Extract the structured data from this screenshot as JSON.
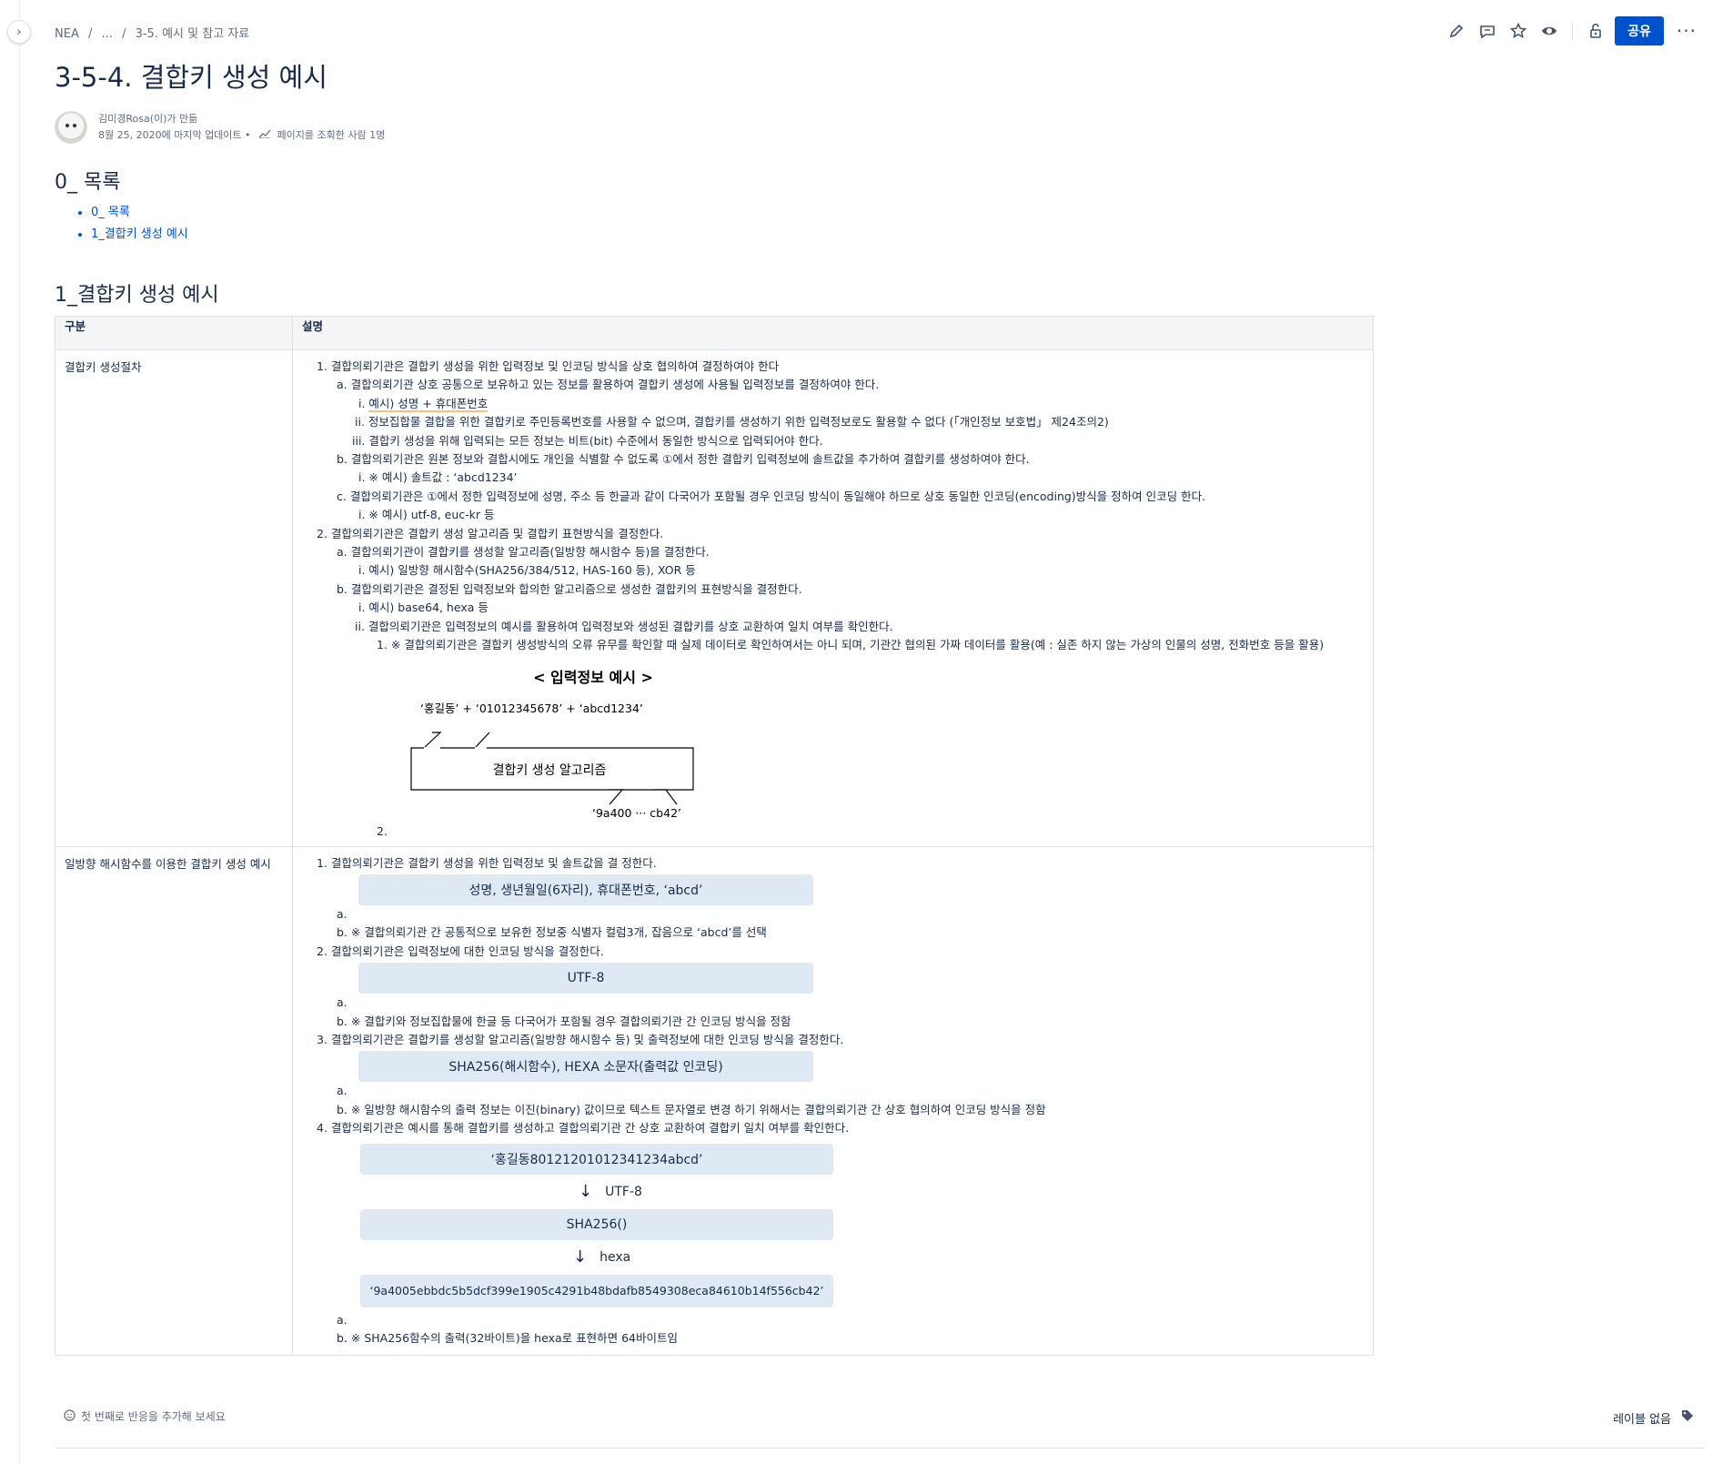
{
  "breadcrumb": {
    "space": "NEA",
    "sep": "/",
    "ellipsis": "...",
    "parent": "3-5. 예시 및 참고 자료"
  },
  "toolbar": {
    "share_label": "공유",
    "more_label": "···"
  },
  "page": {
    "title": "3-5-4. 결합키 생성 예시",
    "author_line": "김미경Rosa(이)가 만듦",
    "updated_line": "8월 25, 2020에 마지막 업데이트 •",
    "views_line": "페이지를 조회한 사람 1명"
  },
  "toc": {
    "heading": "0_ 목록",
    "items": [
      "0_ 목록",
      "1_결합키 생성 예시"
    ]
  },
  "section1": {
    "heading": "1_결합키 생성 예시"
  },
  "table": {
    "headers": [
      "구분",
      "설명"
    ],
    "row1": {
      "label": "결합키 생성절차",
      "lines": [
        "1. 결합의뢰기관은 결합키 생성을 위한 입력정보 및 인코딩 방식을 상호 협의하여 결정하여야 한다",
        "a. 결합의뢰기관 상호 공통으로 보유하고 있는 정보를 활용하여 결합키 생성에 사용될 입력정보를 결정하여야 한다.",
        "i. ",
        "ii. 정보집합물 결합을 위한 결합키로 주민등록번호를 사용할 수 없으며, 결합키를 생성하기 위한 입력정보로도 활용할 수 없다 (「개인정보 보호법」 제24조의2)",
        "iii. 결합키 생성을 위해 입력되는 모든 정보는 비트(bit) 수준에서 동일한 방식으로 입력되어야 한다.",
        "b. 결합의뢰기관은 원본 정보와 결합시에도 개인을 식별할 수 없도록 ①에서 정한 결합키 입력정보에 솔트값을 추가하여 결합키를 생성하여야 한다.",
        "i. ※ 예시) 솔트값 : ‘abcd1234’",
        "c. 결합의뢰기관은 ①에서 정한 입력정보에 성명, 주소 등 한글과 같이 다국어가 포함될 경우 인코딩 방식이 동일해야 하므로 상호 동일한 인코딩(encoding)방식을 정하여 인코딩 한다.",
        "i. ※ 예시) utf-8, euc-kr 등",
        "2. 결합의뢰기관은 결합키 생성 알고리즘 및 결합키 표현방식을 결정한다.",
        "a. 결합의뢰기관이 결합키를 생성할 알고리즘(일방향 해시함수 등)을 결정한다.",
        "i. 예시) 일방향 해시함수(SHA256/384/512, HAS-160 등), XOR 등",
        "b. 결합의뢰기관은 결정된 입력정보와 합의한 알고리즘으로 생성한 결합키의 표현방식을 결정한다.",
        "i. 예시) base64, hexa 등",
        "ii. 결합의뢰기관은 입력정보의 예시를 활용하여 입력정보와 생성된 결합키를 상호 교환하여 일치 여부를 확인한다.",
        "1. ※ 결합의뢰기관은 결합키 생성방식의 오류 유무를 확인할 때 실제 데이터로 확인하여서는 아니 되며, 기관간 협의된 가짜 데이터를 활용(예 : 실존 하지 않는 가상의 인물의 성명, 전화번호 등을 활용)"
      ],
      "highlight_text": "예시) 성명 + 휴대폰번호",
      "diagram": {
        "title": "< 입력정보 예시 >",
        "input_text": "‘홍길동’ + ‘01012345678’ + ‘abcd1234’",
        "algo_label": "결합키 생성 알고리즘",
        "output_text": "‘9a400 ··· cb42’"
      },
      "trailing_marker": "2."
    },
    "row2": {
      "label": "일방향 해시함수를 이용한 결합키 생성 예시",
      "step1": "1. 결합의뢰기관은 결합키 생성을 위한 입력정보 및 솔트값을 결 정한다.",
      "box1": "성명, 생년월일(6자리), 휴대폰번호, ‘abcd’",
      "marker_a": "a.",
      "step1b": "b. ※ 결합의뢰기관 간 공통적으로 보유한 정보중 식별자 컬럼3개, 잡음으로 ‘abcd’를 선택",
      "step2": "2. 결합의뢰기관은 입력정보에 대한 인코딩 방식을 결정한다.",
      "box2": "UTF-8",
      "step2b": "b. ※ 결합키와 정보집합물에 한글 등 다국어가 포함될 경우 결합의뢰기관 간 인코딩 방식을 정함",
      "step3": "3. 결합의뢰기관은 결합키를 생성할 알고리즘(일방향 해시함수 등) 및 출력정보에 대한 인코딩 방식을 결정한다.",
      "box3": "SHA256(해시함수), HEXA 소문자(출력값 인코딩)",
      "step3b": "b. ※ 일방향 해시함수의 출력 정보는 이진(binary) 값이므로 텍스트 문자열로 변경 하기 위해서는 결합의뢰기관 간 상호 협의하여 인코딩 방식을 정함",
      "step4": "4. 결합의뢰기관은 예시를 통해 결합키를 생성하고 결합의뢰기관 간 상호 교환하여 결합키 일치 여부를 확인한다.",
      "flow_input": "‘홍길동80121201012341234abcd’",
      "arrow_glyph": "↓",
      "flow_enc": "UTF-8",
      "flow_func": "SHA256()",
      "flow_rep": "hexa",
      "flow_output": "‘9a4005ebbdc5b5dcf399e1905c4291b48bdafb8549308eca84610b14f556cb42’",
      "step4b": "b. ※ SHA256함수의 출력(32바이트)을 hexa로 표현하면 64바이트임"
    }
  },
  "footer": {
    "reaction_label": "첫 번째로 반응을 추가해 보세요",
    "labels_label": "레이블 없음"
  },
  "colors": {
    "accent": "#0052cc",
    "box_bg": "#dfe9f3",
    "highlight": "#f4c37d"
  }
}
